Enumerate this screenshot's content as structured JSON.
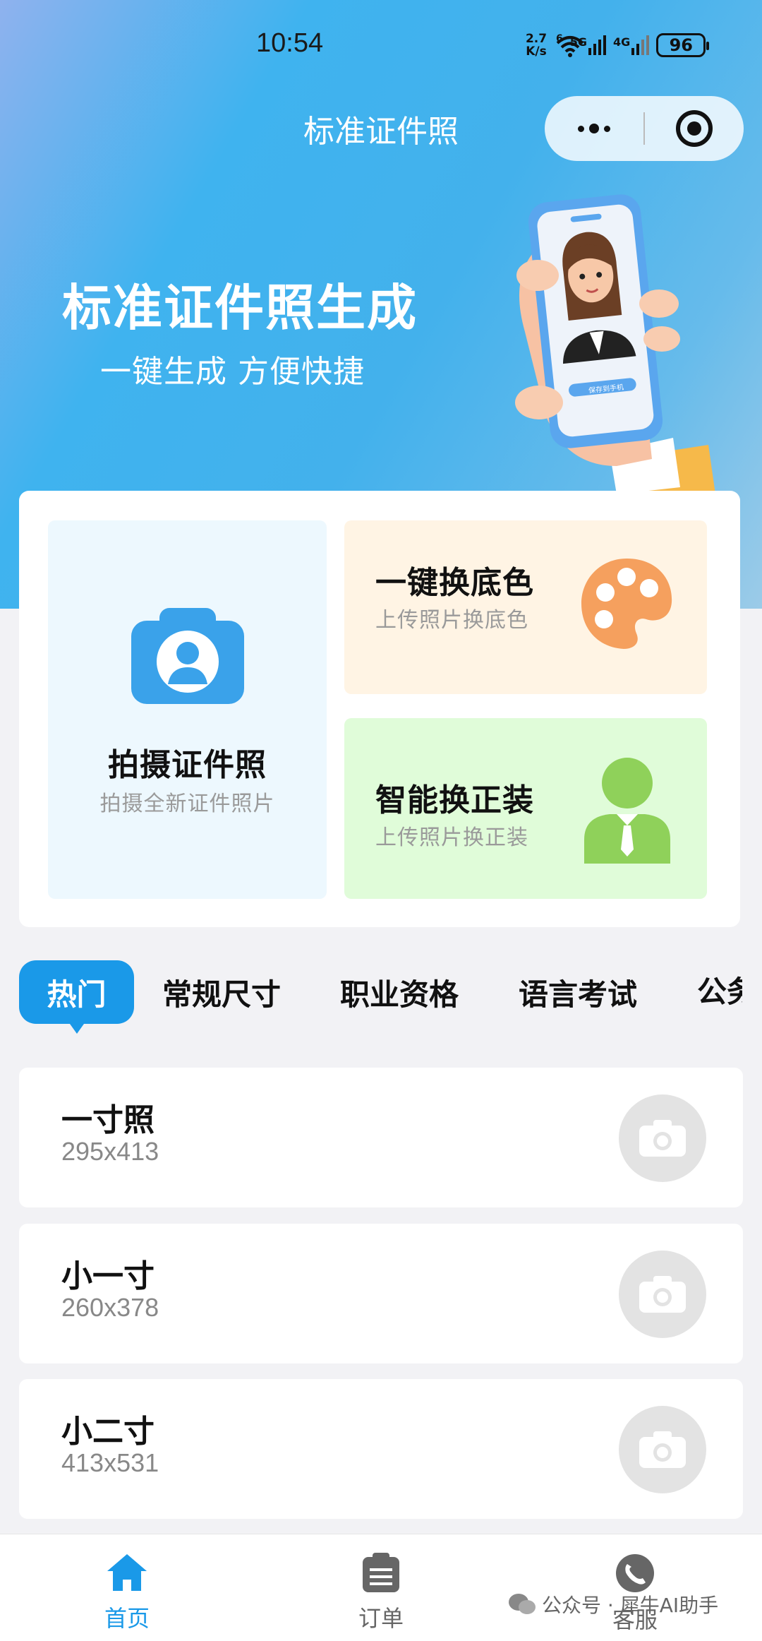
{
  "status_bar": {
    "time": "10:54",
    "net_speed_top": "2.7",
    "net_speed_bottom": "K/s",
    "wifi_badge": "6",
    "sim1": "5G",
    "sim2": "4G",
    "battery": "96"
  },
  "nav": {
    "title": "标准证件照"
  },
  "hero": {
    "title": "标准证件照生成",
    "subtitle": "一键生成 方便快捷",
    "phone_button": "保存到手机"
  },
  "features": {
    "shoot": {
      "title": "拍摄证件照",
      "desc": "拍摄全新证件照片",
      "icon": "camera-portrait-icon",
      "color": "#3aa2ea"
    },
    "background": {
      "title": "一键换底色",
      "desc": "上传照片换底色",
      "icon": "palette-icon",
      "color": "#f5a05e"
    },
    "suit": {
      "title": "智能换正装",
      "desc": "上传照片换正装",
      "icon": "person-suit-icon",
      "color": "#8fd15a"
    }
  },
  "tabs": [
    "热门",
    "常规尺寸",
    "职业资格",
    "语言考试",
    "公务"
  ],
  "active_tab": "热门",
  "sizes": [
    {
      "name": "一寸照",
      "dims": "295x413"
    },
    {
      "name": "小一寸",
      "dims": "260x378"
    },
    {
      "name": "小二寸",
      "dims": "413x531"
    }
  ],
  "tabbar": [
    {
      "label": "首页",
      "icon": "home-icon",
      "active": true
    },
    {
      "label": "订单",
      "icon": "clipboard-icon",
      "active": false
    },
    {
      "label": "客服",
      "icon": "phone-chat-icon",
      "active": false
    }
  ],
  "watermark": "公众号 · 犀牛AI助手",
  "colors": {
    "accent": "#1a99e8",
    "hero_start": "#8fb2ee",
    "hero_mid": "#3fb3ef"
  }
}
